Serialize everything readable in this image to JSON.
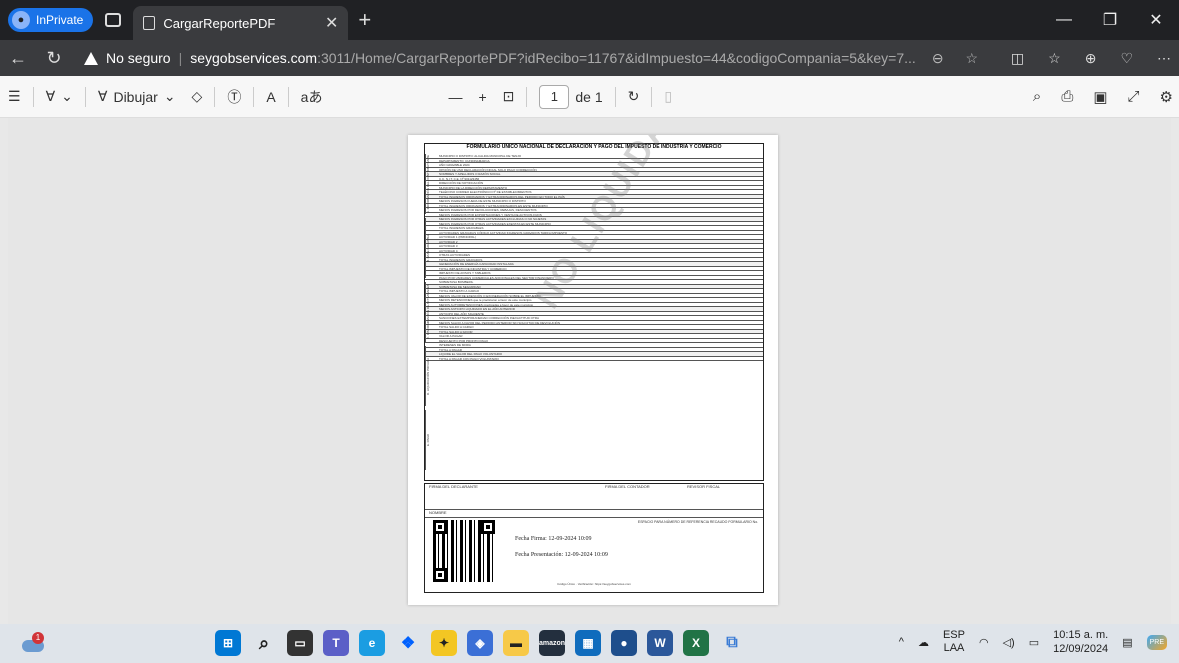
{
  "browser": {
    "inprivate_label": "InPrivate",
    "tab_title": "CargarReportePDF",
    "insecure_label": "No seguro",
    "url_host": "seygobservices.com",
    "url_rest": ":3011/Home/CargarReportePDF?idRecibo=11767&idImpuesto=44&codigoCompania=5&key=7..."
  },
  "pdf_toolbar": {
    "draw_label": "Dibujar",
    "page_current": "1",
    "page_total": "de 1"
  },
  "document": {
    "title": "FORMULARIO ÚNICO NACIONAL DE DECLARACIÓN Y PAGO DEL IMPUESTO DE INDUSTRIA Y COMERCIO",
    "lines": [
      "MUNICIPIO O DISTRITO: ALCALDIA MUNICIPAL DE TENJO",
      "DEPARTAMENTO: CUNDINAMARCA",
      "AÑO GRAVABLE 2024",
      "OPCIÓN DE USO  DECLARACIÓN INICIAL  SOLO PAGO  CORRECCIÓN",
      "NOMBRES Y APELLIDOS O RAZÓN SOCIAL",
      "C.C.  N.I.T.  C.E.  Nº 901123456",
      "DIRECCIÓN DE NOTIFICACIÓN",
      "MUNICIPIO DE LA DIRECCIÓN  DEPARTAMENTO",
      "TELÉFONO  CORREO ELECTRÓNICO  Nº DE ESTABLECIMIENTOS",
      "TOTAL INGRESOS ORDINARIOS Y EXTRAORDINARIOS DEL PERIODO EN TODO EL PAÍS",
      "MENOS INGRESOS FUERA DE ESTE MUNICIPIO O DISTRITO",
      "TOTAL INGRESOS ORDINARIOS Y EXTRAORDINARIOS EN ESTE MUNICIPIO",
      "MENOS INGRESOS POR DEVOLUCIONES, REBAJAS, DESCUENTOS",
      "MENOS INGRESOS POR EXPORTACIONES Y VENTA DE ACTIVOS FIJOS",
      "MENOS INGRESOS POR OTRAS ACTIVIDADES EXCLUIDAS O NO SUJETAS",
      "MENOS INGRESOS POR OTRAS ACTIVIDADES EXENTAS EN ESTE MUNICIPIO",
      "TOTAL INGRESOS GRAVABLES",
      "ACTIVIDADES GRAVADAS  CÓDIGO ACTIVIDAD  INGRESOS GRAVADOS  TARIFA  IMPUESTO",
      "ACTIVIDAD 1 (PRINCIPAL)",
      "ACTIVIDAD 2",
      "ACTIVIDAD 3",
      "ACTIVIDAD 4",
      "OTRAS ACTIVIDADES",
      "TOTAL INGRESOS GRAVADOS",
      "GENERACIÓN DE ENERGÍA  CAPACIDAD INSTALADA",
      "TOTAL IMPUESTO DE INDUSTRIA Y COMERCIO",
      "IMPUESTO DE AVISOS Y TABLEROS",
      "PAGO POR UNIDADES COMERCIALES ADICIONALES DEL SECTOR FINANCIERO",
      "SOBRETASA BOMBERIL",
      "SOBRETASA DE SEGURIDAD",
      "TOTAL IMPUESTO A CARGO",
      "MENOS VALOR DE EXENCIÓN O EXONERACIÓN SOBRE EL IMPUESTO",
      "MENOS RETENCIONES que le practicaron a favor de este municipio",
      "MENOS AUTORRETENCIONES practicadas a favor de este municipio",
      "MENOS ANTICIPO LIQUIDADO EN EL AÑO ANTERIOR",
      "ANTICIPO DEL AÑO SIGUIENTE",
      "SANCIONES  EXTEMPORANEIDAD  CORRECCIÓN  INEXACTITUD  OTRA",
      "MENOS SALDO A FAVOR DEL PERIODO ANTERIOR SIN SOLICITUD DE DEVOLUCIÓN",
      "TOTAL SALDO A CARGO",
      "TOTAL SALDO A FAVOR",
      "VALOR A PAGAR",
      "DESCUENTO POR PRONTO PAGO",
      "INTERESES DE MORA",
      "TOTAL A PAGAR",
      "LIQUIDE EL VALOR DEL PAGO VOLUNTARIO",
      "TOTAL A PAGAR CON PAGO VOLUNTARIO"
    ],
    "side_labels": [
      "A. INFORMACIÓN DEL CONTRIBUYENTE",
      "B. BASE GRAVABLE",
      "C. DISCRIMINACIÓN DE ACTIVIDADES",
      "D. LIQUIDACIÓN PRIVADA",
      "E. PAGO"
    ],
    "watermark": "NO LIQUIDADA",
    "signatures": {
      "declarante": "FIRMA DEL DECLARANTE",
      "contador": "FIRMA DEL CONTADOR",
      "revisor": "REVISOR FISCAL",
      "nombre": "NOMBRE"
    },
    "fecha_firma": "Fecha Firma: 12-09-2024 10:09",
    "fecha_presentacion": "Fecha Presentación: 12-09-2024 10:09",
    "ref_label": "ESPACIO PARA NÚMERO DE REFERENCIA RECAUDO FORMULARIO No.",
    "verificacion": "Código Único · Verificación: https://seygobservices.com"
  },
  "taskbar": {
    "weather_badge": "1",
    "lang_top": "ESP",
    "lang_bottom": "LAA",
    "time": "10:15 a. m.",
    "date": "12/09/2024",
    "copilot_badge": "PRE"
  }
}
